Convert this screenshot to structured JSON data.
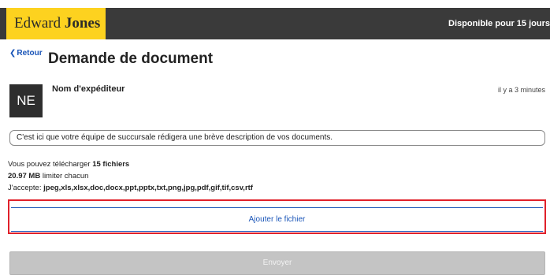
{
  "header": {
    "logo_word1": "Edward",
    "logo_word2": "Jones",
    "availability": "Disponible pour 15 jours"
  },
  "nav": {
    "back_label": "Retour",
    "page_title": "Demande de document"
  },
  "message": {
    "avatar_initials": "NE",
    "sender_name": "Nom d'expéditeur",
    "timestamp": "il y a 3 minutes",
    "description": "C'est ici que votre équipe de succursale rédigera une brève description de vos documents."
  },
  "upload_info": {
    "line1_prefix": "Vous pouvez télécharger ",
    "line1_count": "15 fichiers",
    "line2_size": "20.97 MB",
    "line2_suffix": " limiter chacun",
    "line3_prefix": "J'accepte: ",
    "line3_types": "jpeg,xls,xlsx,doc,docx,ppt,pptx,txt,png,jpg,pdf,gif,tif,csv,rtf"
  },
  "actions": {
    "add_file_label": "Ajouter le fichier",
    "send_label": "Envoyer"
  },
  "colors": {
    "brand_yellow": "#fdd21f",
    "header_bg": "#3a3a3a",
    "link_blue": "#1a55b8",
    "highlight_red": "#e0212b",
    "disabled_gray": "#c4c4c4"
  }
}
